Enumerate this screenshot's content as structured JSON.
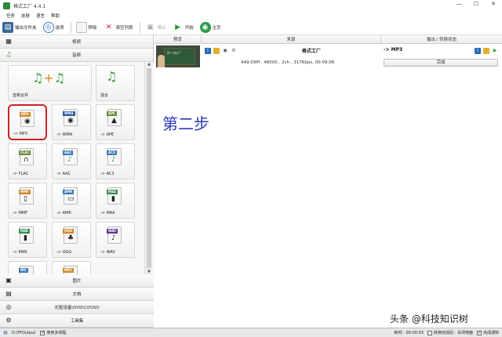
{
  "window": {
    "title": "格式工厂 4.4.1",
    "minimize": "—",
    "maximize": "☐",
    "close": "✕"
  },
  "menu": [
    "任务",
    "皮肤",
    "语言",
    "帮助"
  ],
  "toolbar": {
    "output_folder": "输出文件夹",
    "options": "选项",
    "remove": "移除",
    "clear_list": "清空列表",
    "stop": "停止",
    "start": "开始",
    "home": "主页"
  },
  "categories_top": {
    "video": "视频",
    "audio": "音频"
  },
  "tiles": [
    {
      "label": "音频合并",
      "tag": "",
      "color": "#3a9a3a"
    },
    {
      "label": "混合",
      "tag": "",
      "color": "#3a9a3a"
    },
    {
      "label": "-> MP3",
      "tag": "MP3",
      "color": "#d08a2a"
    },
    {
      "label": "-> WMA",
      "tag": "WMA",
      "color": "#2a5aa8"
    },
    {
      "label": "-> APE",
      "tag": "APE",
      "color": "#6a8a3a"
    },
    {
      "label": "-> FLAC",
      "tag": "FLAC",
      "color": "#6a8a3a"
    },
    {
      "label": "-> AAC",
      "tag": "AAC",
      "color": "#3a7ab8"
    },
    {
      "label": "-> AC3",
      "tag": "AC3",
      "color": "#3a7ab8"
    },
    {
      "label": "-> MMF",
      "tag": "MMF",
      "color": "#d08a2a"
    },
    {
      "label": "-> AMR",
      "tag": "AMR",
      "color": "#3a7ab8"
    },
    {
      "label": "-> M4A",
      "tag": "M4A",
      "color": "#3a8a5a"
    },
    {
      "label": "-> M4R",
      "tag": "M4R",
      "color": "#3a8a5a"
    },
    {
      "label": "-> OGG",
      "tag": "OGG",
      "color": "#d08a2a"
    },
    {
      "label": "-> WAV",
      "tag": "WAV",
      "color": "#5a3a8a"
    },
    {
      "label": "",
      "tag": "WV",
      "color": "#3a7ab8"
    },
    {
      "label": "",
      "tag": "MP2",
      "color": "#d08a2a"
    }
  ],
  "categories_bottom": {
    "image": "图片",
    "document": "文档",
    "disc": "光驱设备\\DVD\\CD\\ISO",
    "tools": "工具集"
  },
  "table": {
    "headers": {
      "preview": "预览",
      "source": "来源",
      "output": "输出 / 转换状态"
    },
    "row": {
      "board_text": "E=mc²",
      "name": "格式工厂",
      "info": "449.09M , 48000 , 2ch , 317Kbps, 00:09:06",
      "output_format": "-> MP3",
      "status": "完成"
    }
  },
  "overlay": {
    "step": "第二步",
    "watermark": "头条 @科技知识树"
  },
  "statusbar": {
    "path": "D:\\FFOutput",
    "multithread": "使用多线程",
    "elapsed": "耗时：00:00:03",
    "after_convert": "转换完成后：关闭电脑",
    "notify": "完成通知"
  },
  "colors": {
    "highlight": "#cc2222",
    "step_text": "#2a39b8"
  }
}
